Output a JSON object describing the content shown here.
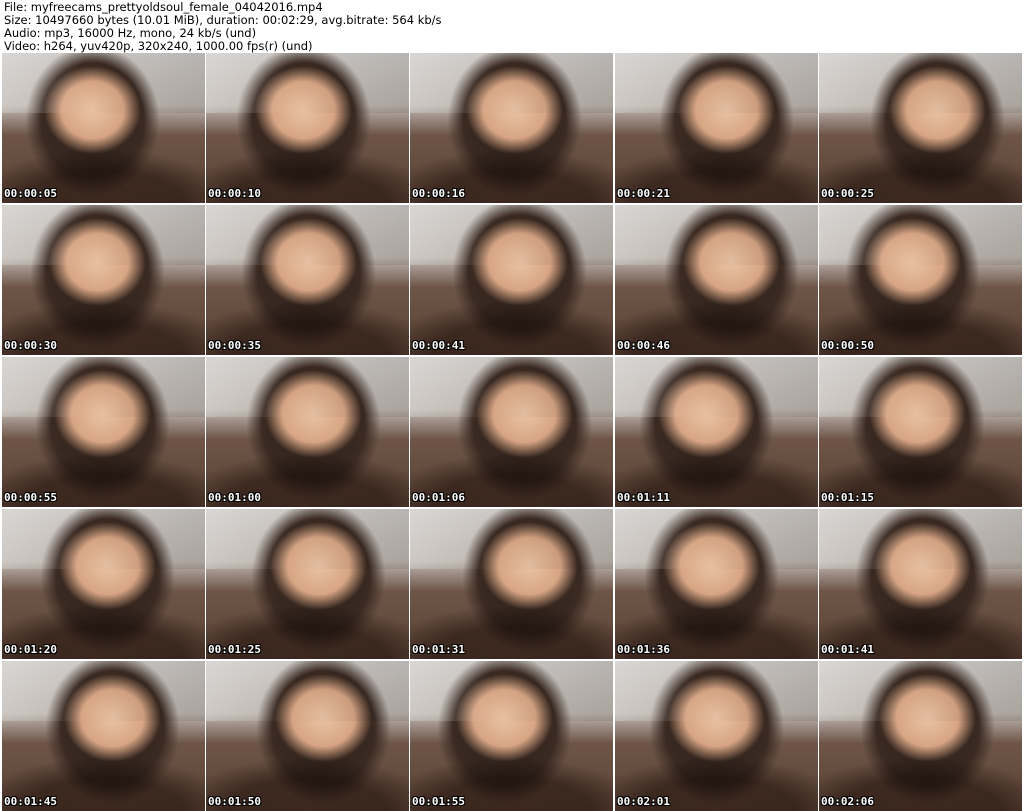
{
  "meta": {
    "file": "File: myfreecams_prettyoldsoul_female_04042016.mp4",
    "size": "Size: 10497660 bytes (10.01 MiB), duration: 00:02:29, avg.bitrate: 564 kb/s",
    "audio": "Audio: mp3, 16000 Hz, mono, 24 kb/s (und)",
    "video": "Video: h264, yuv420p, 320x240, 1000.00 fps(r) (und)"
  },
  "thumbnails": [
    "00:00:05",
    "00:00:10",
    "00:00:16",
    "00:00:21",
    "00:00:25",
    "00:00:30",
    "00:00:35",
    "00:00:41",
    "00:00:46",
    "00:00:50",
    "00:00:55",
    "00:01:00",
    "00:01:06",
    "00:01:11",
    "00:01:15",
    "00:01:20",
    "00:01:25",
    "00:01:31",
    "00:01:36",
    "00:01:41",
    "00:01:45",
    "00:01:50",
    "00:01:55",
    "00:02:01",
    "00:02:06"
  ]
}
